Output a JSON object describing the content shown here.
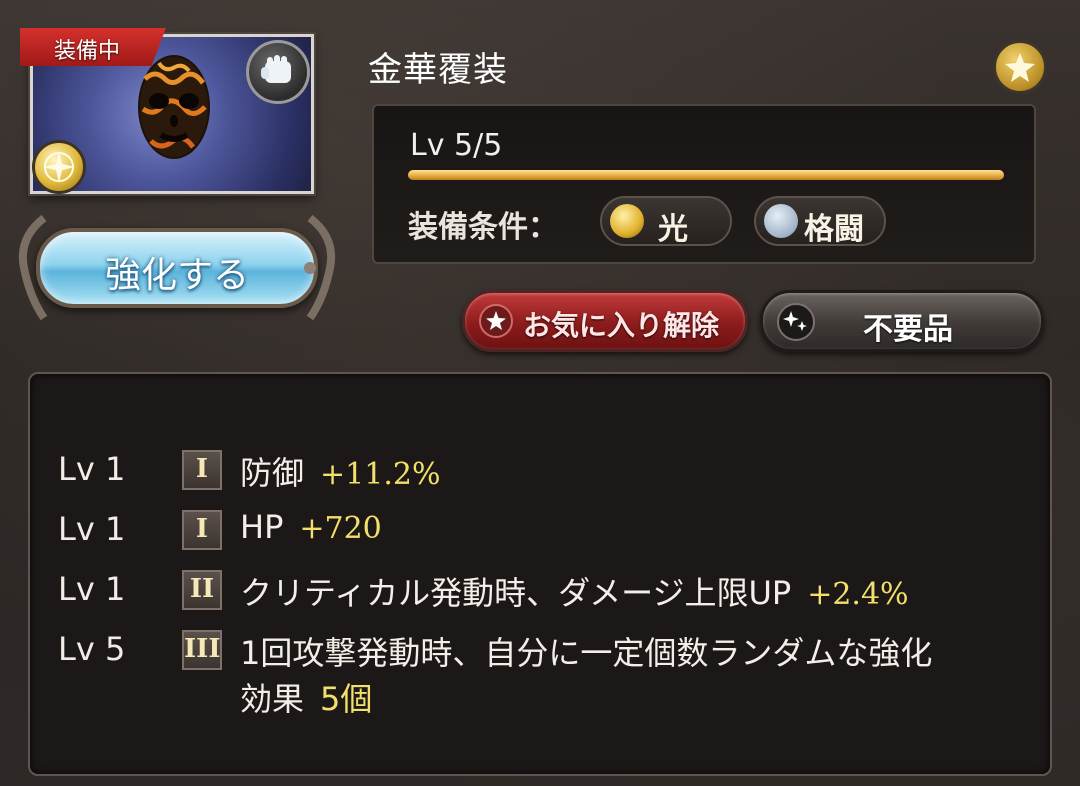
{
  "item": {
    "name": "金華覆装",
    "equipped_tag": "装備中",
    "level_text": "Lv 5/5",
    "level_progress": 1.0,
    "enhance_label": "強化する",
    "condition_label": "装備条件：",
    "conditions": [
      {
        "label": "光",
        "icon": "light-element-icon"
      },
      {
        "label": "格闘",
        "icon": "fist-icon"
      }
    ]
  },
  "buttons": {
    "unfavorite_label": "お気に入り解除",
    "junk_label": "不要品"
  },
  "skills": [
    {
      "level": "Lv 1",
      "rank": "I",
      "desc": "防御",
      "value": "+11.2%"
    },
    {
      "level": "Lv 1",
      "rank": "I",
      "desc": "HP",
      "value": "+720"
    },
    {
      "level": "Lv 1",
      "rank": "II",
      "desc": "クリティカル発動時、ダメージ上限UP",
      "value": "+2.4%"
    },
    {
      "level": "Lv 5",
      "rank": "III",
      "desc": "1回攻撃発動時、自分に一定個数ランダムな強化",
      "desc2": "効果",
      "value": "5個"
    }
  ],
  "colors": {
    "value_yellow": "#f2e06a",
    "bar_gold": "#e3a93a",
    "tag_red": "#c8282a",
    "enhance_blue": "#8fd2ee"
  }
}
